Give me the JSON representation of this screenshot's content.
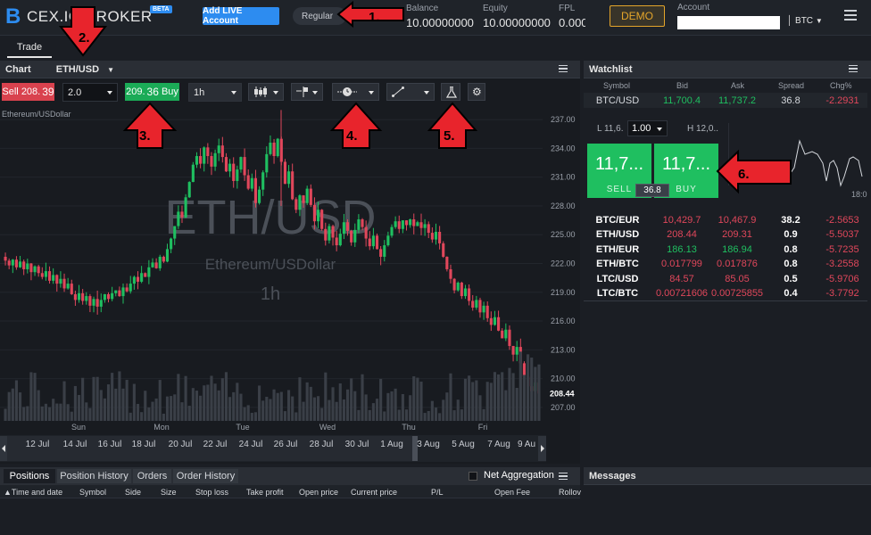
{
  "header": {
    "logo_text": "CEX.IO BROKER",
    "beta": "BETA",
    "add_live": "Add LIVE Account",
    "regular": "Regular",
    "balance_label": "Balance",
    "balance_value": "10.00000000",
    "equity_label": "Equity",
    "equity_value": "10.00000000",
    "fpl_label": "FPL",
    "fpl_value": "0.000",
    "demo": "DEMO",
    "account_label": "Account",
    "account_currency": "BTC"
  },
  "tabs": {
    "trade": "Trade"
  },
  "chart_panel": {
    "title": "Chart",
    "symbol": "ETH/USD",
    "sell_label": "Sell",
    "sell_price_small": "208.",
    "sell_price_big": "39",
    "amount": "2.0",
    "buy_price_small": "209.",
    "buy_price_big": "36",
    "buy_label": "Buy",
    "interval": "1h",
    "series_title": "Ethereum/USDollar",
    "watermark_symbol": "ETH/USD",
    "watermark_name": "Ethereum/USDollar",
    "watermark_interval": "1h",
    "last_price": "208.44",
    "day_labels": [
      "Sun",
      "Mon",
      "Tue",
      "Wed",
      "Thu",
      "Fri"
    ],
    "date_labels": [
      "12 Jul",
      "14 Jul",
      "16 Jul",
      "18 Jul",
      "20 Jul",
      "22 Jul",
      "24 Jul",
      "26 Jul",
      "28 Jul",
      "30 Jul",
      "1 Aug",
      "3 Aug",
      "5 Aug",
      "7 Aug",
      "9 Au"
    ]
  },
  "annotations": [
    "1.",
    "2.",
    "3.",
    "4.",
    "5.",
    "6."
  ],
  "watchlist": {
    "title": "Watchlist",
    "columns": [
      "Symbol",
      "Bid",
      "Ask",
      "Spread",
      "Chg%"
    ],
    "top_row": {
      "symbol": "BTC/USD",
      "bid": "11,700.4",
      "ask": "11,737.2",
      "spread": "36.8",
      "chg": "-2.2931"
    },
    "trade_widget": {
      "low": "L 11,6.",
      "amount": "1.00",
      "high": "H 12,0..",
      "sell_price": "11,7...",
      "buy_price": "11,7...",
      "sell": "SELL",
      "buy": "BUY",
      "spread": "36.8",
      "time": "18:0"
    },
    "rows": [
      {
        "symbol": "BTC/EUR",
        "bid": "10,429.7",
        "ask": "10,467.9",
        "spread": "38.2",
        "chg": "-2.5653",
        "bid_color": "red",
        "ask_color": "red"
      },
      {
        "symbol": "ETH/USD",
        "bid": "208.44",
        "ask": "209.31",
        "spread": "0.9",
        "chg": "-5.5037",
        "bid_color": "red",
        "ask_color": "red"
      },
      {
        "symbol": "ETH/EUR",
        "bid": "186.13",
        "ask": "186.94",
        "spread": "0.8",
        "chg": "-5.7235",
        "bid_color": "green",
        "ask_color": "green"
      },
      {
        "symbol": "ETH/BTC",
        "bid": "0.017799",
        "ask": "0.017876",
        "spread": "0.8",
        "chg": "-3.2558",
        "bid_color": "red",
        "ask_color": "red"
      },
      {
        "symbol": "LTC/USD",
        "bid": "84.57",
        "ask": "85.05",
        "spread": "0.5",
        "chg": "-5.9706",
        "bid_color": "red",
        "ask_color": "red"
      },
      {
        "symbol": "LTC/BTC",
        "bid": "0.00721606",
        "ask": "0.00725855",
        "spread": "0.4",
        "chg": "-3.7792",
        "bid_color": "red",
        "ask_color": "red"
      }
    ]
  },
  "positions": {
    "tabs": [
      "Positions",
      "Position History",
      "Orders",
      "Order History"
    ],
    "net_aggregation": "Net Aggregation",
    "columns": [
      "Time and date",
      "Symbol",
      "Side",
      "Size",
      "Stop loss",
      "Take profit",
      "Open price",
      "Current price",
      "P/L",
      "Open Fee",
      "Rollov"
    ]
  },
  "messages": {
    "title": "Messages"
  },
  "chart_data": {
    "type": "candlestick",
    "ylim": [
      205.5,
      238.5
    ],
    "y_ticks": [
      "237.00",
      "234.00",
      "231.00",
      "228.00",
      "225.00",
      "222.00",
      "219.00",
      "216.00",
      "213.00",
      "210.00",
      "207.00"
    ],
    "closes": [
      222.3,
      221.8,
      222.4,
      221.6,
      222.2,
      221.4,
      222.0,
      221.1,
      221.7,
      221.0,
      220.6,
      221.2,
      220.2,
      220.8,
      219.9,
      220.4,
      219.4,
      219.9,
      218.8,
      218.2,
      218.9,
      218.1,
      218.6,
      217.6,
      218.3,
      217.5,
      218.2,
      218.8,
      218.3,
      218.9,
      219.2,
      218.6,
      219.5,
      219.1,
      219.9,
      220.6,
      220.1,
      221.0,
      220.6,
      221.6,
      222.1,
      221.5,
      222.7,
      222.2,
      223.5,
      224.6,
      225.9,
      227.4,
      226.8,
      228.9,
      230.5,
      232.3,
      233.2,
      232.4,
      234.1,
      233.2,
      232.1,
      233.5,
      234.3,
      233.1,
      231.6,
      232.4,
      230.6,
      231.8,
      233.1,
      231.2,
      229.8,
      230.9,
      228.3,
      229.7,
      231.5,
      233.4,
      234.6,
      233.2,
      235.0,
      232.6,
      230.3,
      231.6,
      228.7,
      227.6,
      229.1,
      228.3,
      229.8,
      228.1,
      226.4,
      227.6,
      225.6,
      224.4,
      225.9,
      224.7,
      223.9,
      225.1,
      226.3,
      225.4,
      224.2,
      225.5,
      226.6,
      225.8,
      224.6,
      223.8,
      224.9,
      223.5,
      222.7,
      223.9,
      224.9,
      225.8,
      226.4,
      225.6,
      226.5,
      226.0,
      226.6,
      225.9,
      226.3,
      225.7,
      226.1,
      225.2,
      224.5,
      225.3,
      224.1,
      222.7,
      221.4,
      220.4,
      219.2,
      220.0,
      218.6,
      219.4,
      218.1,
      217.4,
      218.2,
      216.9,
      217.6,
      216.3,
      215.6,
      216.4,
      215.0,
      214.2,
      215.1,
      213.4,
      212.5,
      213.3,
      211.6,
      210.2,
      209.2,
      208.7,
      209.6,
      208.44
    ],
    "volume_note": "volume bars along bottom"
  }
}
